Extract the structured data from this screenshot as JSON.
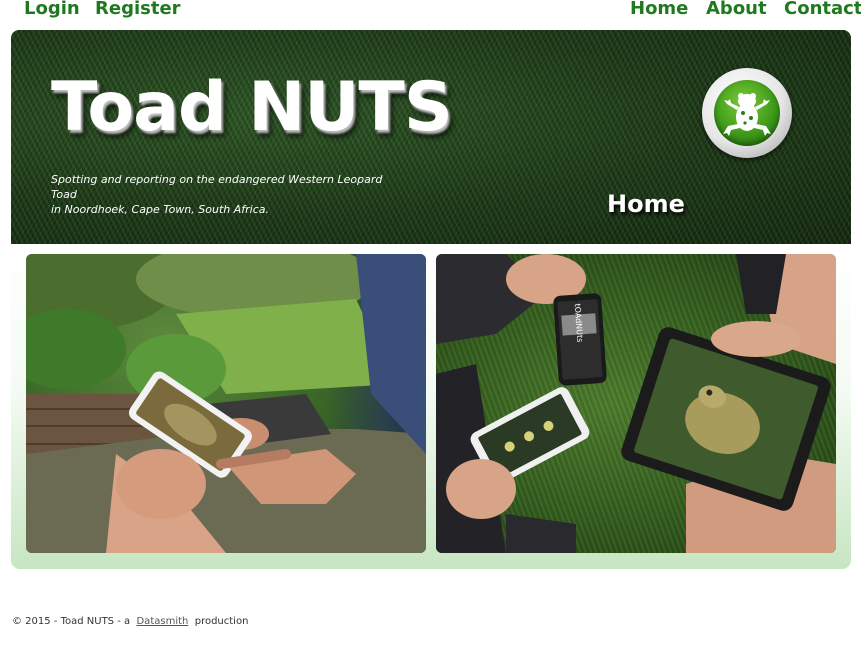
{
  "nav": {
    "left": [
      {
        "label": "Login"
      },
      {
        "label": "Register"
      }
    ],
    "right": [
      {
        "label": "Home"
      },
      {
        "label": "About"
      },
      {
        "label": "Contact"
      }
    ]
  },
  "banner": {
    "title": "Toad NUTS",
    "tagline_line1": "Spotting and reporting on the endangered Western Leopard Toad",
    "tagline_line2": "in Noordhoek, Cape Town, South Africa.",
    "current_page": "Home",
    "logo_icon": "toad-logo-icon"
  },
  "gallery": {
    "photos": [
      {
        "name": "toad-app-on-phone-photo",
        "phone_text": ""
      },
      {
        "name": "toad-app-on-devices-photo",
        "phone_text": "tOAdNUts"
      }
    ]
  },
  "footer": {
    "prefix": "© 2015 - Toad NUTS - a",
    "link": "Datasmith",
    "suffix": "production"
  },
  "colors": {
    "nav_link": "#1f7a1f",
    "banner_grass": "#1d3b17",
    "gallery_bottom": "#c7e6c2",
    "logo_green": "#3f9a19"
  }
}
